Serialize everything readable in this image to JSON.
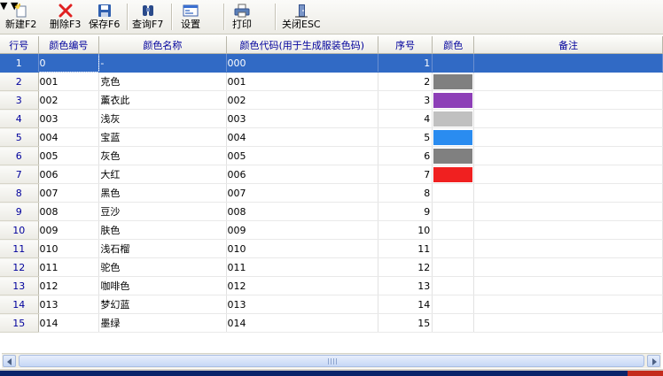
{
  "toolbar": {
    "new_label": "新建F2",
    "delete_label": "删除F3",
    "save_label": "保存F6",
    "query_label": "查询F7",
    "settings_label": "设置",
    "print_label": "打印",
    "close_label": "关闭ESC"
  },
  "columns": {
    "row_no": "行号",
    "color_no": "颜色编号",
    "color_name": "颜色名称",
    "color_code": "颜色代码(用于生成服装色码)",
    "seq": "序号",
    "color": "颜色",
    "note": "备注"
  },
  "rows": [
    {
      "row": "1",
      "code": "0",
      "name": "-",
      "ccode": "000",
      "seq": "1",
      "swatch": ""
    },
    {
      "row": "2",
      "code": "001",
      "name": "克色",
      "ccode": "001",
      "seq": "2",
      "swatch": "#808080"
    },
    {
      "row": "3",
      "code": "002",
      "name": "薰衣此",
      "ccode": "002",
      "seq": "3",
      "swatch": "#8d3fb7"
    },
    {
      "row": "4",
      "code": "003",
      "name": "浅灰",
      "ccode": "003",
      "seq": "4",
      "swatch": "#c0c0c0"
    },
    {
      "row": "5",
      "code": "004",
      "name": "宝蓝",
      "ccode": "004",
      "seq": "5",
      "swatch": "#2a8cf0"
    },
    {
      "row": "6",
      "code": "005",
      "name": "灰色",
      "ccode": "005",
      "seq": "6",
      "swatch": "#808080"
    },
    {
      "row": "7",
      "code": "006",
      "name": "大红",
      "ccode": "006",
      "seq": "7",
      "swatch": "#f02020"
    },
    {
      "row": "8",
      "code": "007",
      "name": "黑色",
      "ccode": "007",
      "seq": "8",
      "swatch": ""
    },
    {
      "row": "9",
      "code": "008",
      "name": "豆沙",
      "ccode": "008",
      "seq": "9",
      "swatch": ""
    },
    {
      "row": "10",
      "code": "009",
      "name": "肤色",
      "ccode": "009",
      "seq": "10",
      "swatch": ""
    },
    {
      "row": "11",
      "code": "010",
      "name": "浅石榴",
      "ccode": "010",
      "seq": "11",
      "swatch": ""
    },
    {
      "row": "12",
      "code": "011",
      "name": "驼色",
      "ccode": "011",
      "seq": "12",
      "swatch": ""
    },
    {
      "row": "13",
      "code": "012",
      "name": "咖啡色",
      "ccode": "012",
      "seq": "13",
      "swatch": ""
    },
    {
      "row": "14",
      "code": "013",
      "name": "梦幻蓝",
      "ccode": "013",
      "seq": "14",
      "swatch": ""
    },
    {
      "row": "15",
      "code": "014",
      "name": "墨绿",
      "ccode": "014",
      "seq": "15",
      "swatch": ""
    }
  ],
  "selection_color": "#316ac5"
}
